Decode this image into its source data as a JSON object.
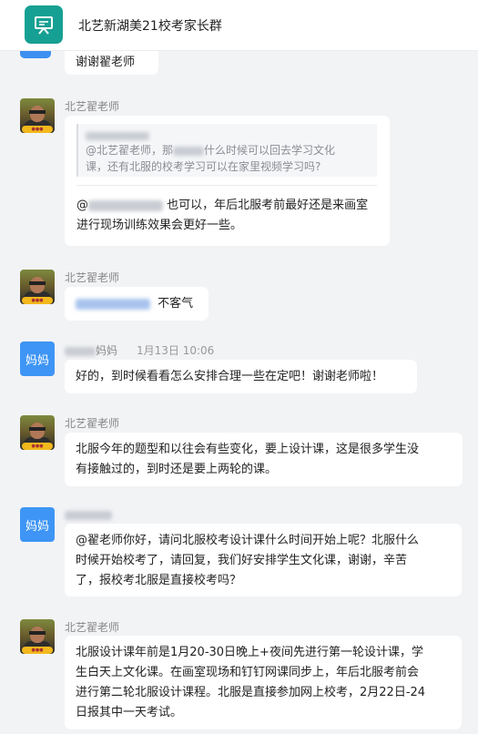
{
  "header": {
    "title": "北艺新湖美21校考家长群",
    "logo_icon": "easel-icon",
    "accent": "#16a093"
  },
  "messages": [
    {
      "text": "谢谢翟老师"
    },
    {
      "sender": "北艺翟老师",
      "quote_sender_prefix": "@北艺翟老师，那",
      "quote_text_1": "什么时候可以回去学习文化",
      "quote_text_2": "课，还有北服的校考学习可以在家里视频学习吗?",
      "reply_text_1": "也可以，年后北服考前最好还是来画室",
      "reply_text_2": "进行现场训练效果会更好一些。"
    },
    {
      "sender": "北艺翟老师",
      "text": "不客气"
    },
    {
      "sender_suffix": "妈妈",
      "time": "1月13日 10:06",
      "avatar_label": "妈妈",
      "text": "好的，到时候看看怎么安排合理一些在定吧！谢谢老师啦！"
    },
    {
      "sender": "北艺翟老师",
      "line1": "北服今年的题型和以往会有些变化，要上设计课，这是很多学生没",
      "line2": "有接触过的，到时还是要上两轮的课。"
    },
    {
      "avatar_label": "妈妈",
      "line1": "@翟老师你好，请问北服校考设计课什么时间开始上呢？北服什么",
      "line2": "时候开始校考了，请回复，我们好安排学生文化课，谢谢，辛苦",
      "line3": "了，报校考北服是直接校考吗？"
    },
    {
      "sender": "北艺翟老师",
      "line1": "北服设计课年前是1月20-30日晚上+夜间先进行第一轮设计课，学",
      "line2": "生白天上文化课。在画室现场和钉钉网课同步上，年后北服考前会",
      "line3": "进行第二轮北服设计课程。北服是直接参加网上校考，2月22日-24",
      "line4": "日报其中一天考试。"
    }
  ]
}
